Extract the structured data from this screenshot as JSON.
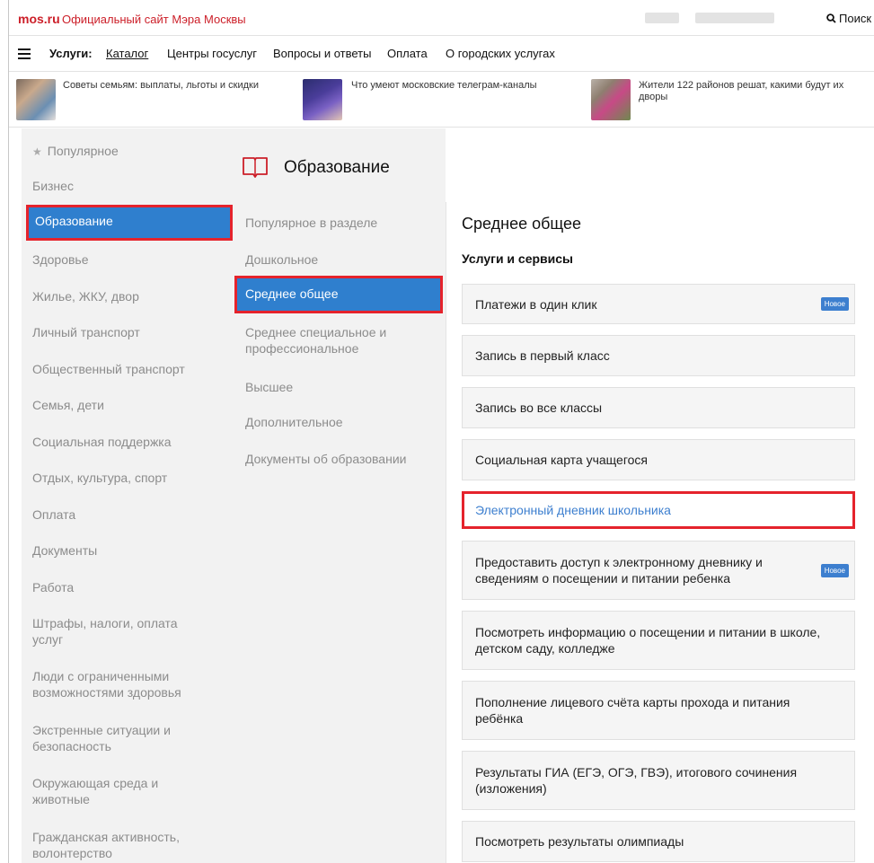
{
  "header": {
    "logo": "mos.ru",
    "site_title": "Официальный сайт Мэра Москвы",
    "search_label": "Поиск"
  },
  "nav": {
    "label": "Услуги:",
    "links": [
      "Каталог",
      "Центры госуслуг",
      "Вопросы и ответы",
      "Оплата",
      "О городских услугах"
    ],
    "active": "Каталог"
  },
  "news": [
    {
      "text": "Советы семьям: выплаты, льготы и скидки"
    },
    {
      "text": "Что умеют московские телеграм-каналы"
    },
    {
      "text": "Жители 122 районов решат, какими будут их дворы"
    }
  ],
  "categories": {
    "popular": "Популярное",
    "items": [
      "Бизнес",
      "Образование",
      "Здоровье",
      "Жилье, ЖКУ, двор",
      "Личный транспорт",
      "Общественный транспорт",
      "Семья, дети",
      "Социальная поддержка",
      "Отдых, культура, спорт",
      "Оплата",
      "Документы",
      "Работа",
      "Штрафы, налоги, оплата услуг",
      "Люди с ограниченными возможностями здоровья",
      "Экстренные ситуации и безопасность",
      "Окружающая среда и животные",
      "Гражданская активность, волонтерство"
    ],
    "selected": "Образование"
  },
  "section": {
    "title": "Образование",
    "icon": "book-icon",
    "subsections": [
      "Популярное в разделе",
      "Дошкольное",
      "Среднее общее",
      "Среднее специальное и профессиональное",
      "Высшее",
      "Дополнительное",
      "Документы об образовании"
    ],
    "selected": "Среднее общее"
  },
  "services": {
    "title": "Среднее общее",
    "subtitle": "Услуги и сервисы",
    "items": [
      {
        "label": "Платежи в один клик",
        "badge": "Новое"
      },
      {
        "label": "Запись в первый класс"
      },
      {
        "label": "Запись во все классы"
      },
      {
        "label": "Социальная карта учащегося"
      },
      {
        "label": "Электронный дневник школьника",
        "highlighted": true
      },
      {
        "label": "Предоставить доступ к электронному дневнику и сведениям о посещении и питании ребенка",
        "badge": "Новое"
      },
      {
        "label": "Посмотреть информацию о посещении и питании в школе, детском саду, колледже"
      },
      {
        "label": "Пополнение лицевого счёта карты прохода и питания ребёнка"
      },
      {
        "label": "Результаты ГИА (ЕГЭ, ОГЭ, ГВЭ), итогового сочинения (изложения)"
      },
      {
        "label": "Посмотреть результаты олимпиады"
      }
    ]
  },
  "colors": {
    "brand_red": "#cc1f29",
    "selected_blue": "#2f7fce",
    "highlight_red": "#e5232c",
    "link_blue": "#3d7fcf"
  }
}
